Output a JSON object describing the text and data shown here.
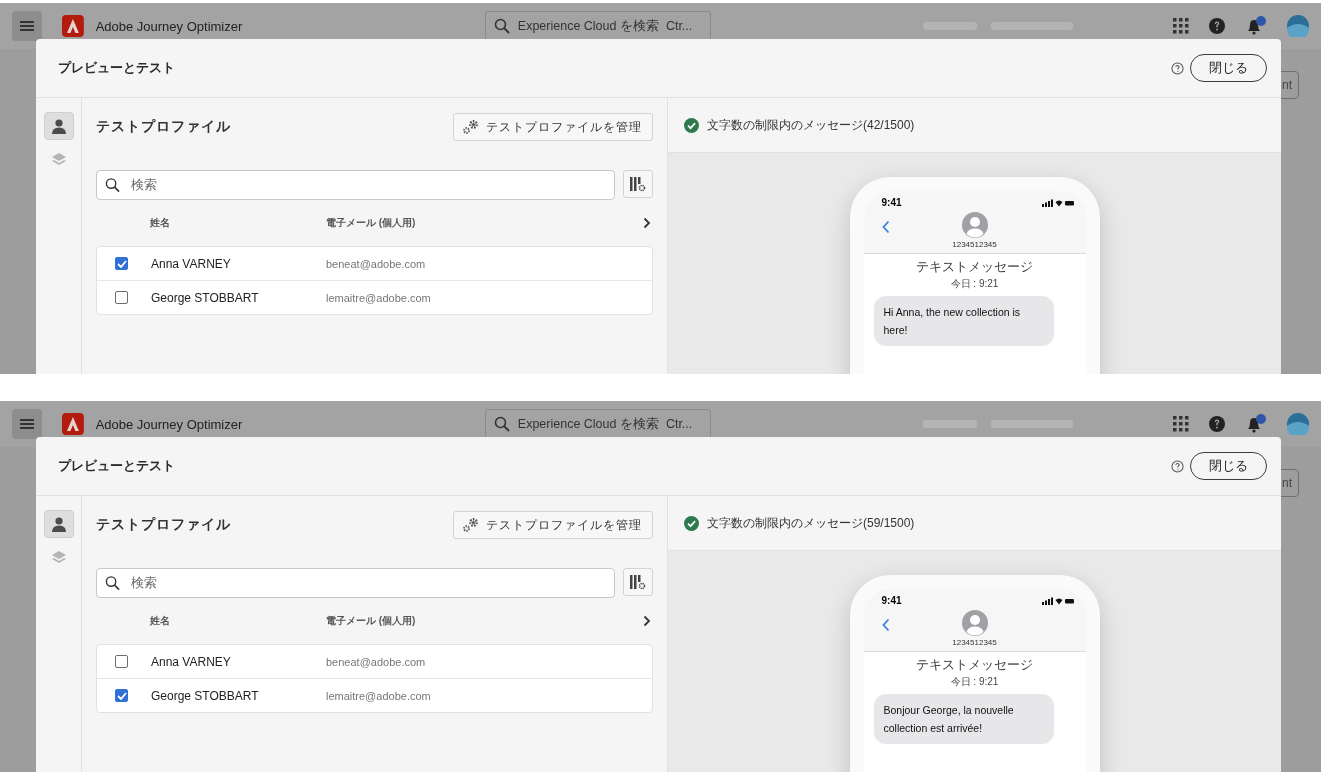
{
  "screens": [
    {
      "shell": {
        "app_name": "Adobe Journey Optimizer",
        "search": {
          "placeholder": "Experience Cloud を検索  Ctr..."
        },
        "page_button": "nt"
      },
      "dialog": {
        "title": "プレビューとテスト",
        "close_button": "閉じる",
        "rail_tabs": [
          {
            "kind": "profile",
            "selected": true
          },
          {
            "kind": "layers",
            "selected": false
          }
        ],
        "section_title": "テストプロファイル",
        "manage_button": "テストプロファイルを管理",
        "search": {
          "placeholder": "検索"
        },
        "table": {
          "columns": [
            "姓名",
            "電子メール (個人用)"
          ],
          "rows": [
            {
              "name": "Anna VARNEY",
              "email": "beneat@adobe.com",
              "checked": true
            },
            {
              "name": "George STOBBART",
              "email": "lemaitre@adobe.com",
              "checked": false
            }
          ]
        },
        "status": "文字数の制限内のメッセージ(42/1500)",
        "phone": {
          "time": "9:41",
          "contact": "1234512345",
          "thread_label": "テキストメッセージ",
          "timestamp": "今日 : 9:21",
          "message": "Hi Anna, the new collection is here!"
        }
      }
    },
    {
      "shell": {
        "app_name": "Adobe Journey Optimizer",
        "search": {
          "placeholder": "Experience Cloud を検索  Ctr..."
        },
        "page_button": "nt"
      },
      "dialog": {
        "title": "プレビューとテスト",
        "close_button": "閉じる",
        "rail_tabs": [
          {
            "kind": "profile",
            "selected": true
          },
          {
            "kind": "layers",
            "selected": false
          }
        ],
        "section_title": "テストプロファイル",
        "manage_button": "テストプロファイルを管理",
        "search": {
          "placeholder": "検索"
        },
        "table": {
          "columns": [
            "姓名",
            "電子メール (個人用)"
          ],
          "rows": [
            {
              "name": "Anna VARNEY",
              "email": "beneat@adobe.com",
              "checked": false
            },
            {
              "name": "George STOBBART",
              "email": "lemaitre@adobe.com",
              "checked": true
            }
          ]
        },
        "status": "文字数の制限内のメッセージ(59/1500)",
        "phone": {
          "time": "9:41",
          "contact": "1234512345",
          "thread_label": "テキストメッセージ",
          "timestamp": "今日 : 9:21",
          "message": "Bonjour George, la nouvelle collection est arrivée!"
        }
      }
    }
  ]
}
